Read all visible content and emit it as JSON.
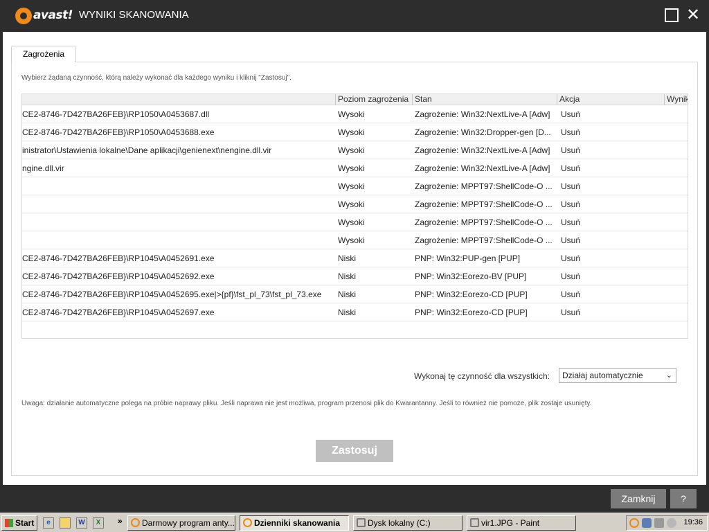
{
  "window": {
    "logo_text": "avast!",
    "title": "WYNIKI SKANOWANIA",
    "close_glyph": "✕"
  },
  "tab": {
    "label": "Zagrożenia"
  },
  "instructions": "Wybierz żądaną czynność, którą należy wykonać dla każdego wyniku i kliknij \"Zastosuj\".",
  "table": {
    "columns": [
      "Poziom zagrożenia",
      "Stan",
      "Akcja",
      "Wynik"
    ],
    "rows": [
      {
        "path": "CE2-8746-7D427BA26FEB}\\RP1050\\A0453687.dll",
        "level": "Wysoki",
        "state": "Zagrożenie: Win32:NextLive-A [Adw]",
        "action": "Usuń"
      },
      {
        "path": "CE2-8746-7D427BA26FEB}\\RP1050\\A0453688.exe",
        "level": "Wysoki",
        "state": "Zagrożenie: Win32:Dropper-gen [D...",
        "action": "Usuń"
      },
      {
        "path": "inistrator\\Ustawienia lokalne\\Dane aplikacji\\genienext\\nengine.dll.vir",
        "level": "Wysoki",
        "state": "Zagrożenie: Win32:NextLive-A [Adw]",
        "action": "Usuń"
      },
      {
        "path": "ngine.dll.vir",
        "level": "Wysoki",
        "state": "Zagrożenie: Win32:NextLive-A [Adw]",
        "action": "Usuń"
      },
      {
        "path": "",
        "level": "Wysoki",
        "state": "Zagrożenie: MPPT97:ShellCode-O ...",
        "action": "Usuń"
      },
      {
        "path": "",
        "level": "Wysoki",
        "state": "Zagrożenie: MPPT97:ShellCode-O ...",
        "action": "Usuń"
      },
      {
        "path": "",
        "level": "Wysoki",
        "state": "Zagrożenie: MPPT97:ShellCode-O ...",
        "action": "Usuń"
      },
      {
        "path": "",
        "level": "Wysoki",
        "state": "Zagrożenie: MPPT97:ShellCode-O ...",
        "action": "Usuń"
      },
      {
        "path": "CE2-8746-7D427BA26FEB}\\RP1045\\A0452691.exe",
        "level": "Niski",
        "state": "PNP: Win32:PUP-gen [PUP]",
        "action": "Usuń"
      },
      {
        "path": "CE2-8746-7D427BA26FEB}\\RP1045\\A0452692.exe",
        "level": "Niski",
        "state": "PNP: Win32:Eorezo-BV [PUP]",
        "action": "Usuń"
      },
      {
        "path": "CE2-8746-7D427BA26FEB}\\RP1045\\A0452695.exe|>{pf}\\fst_pl_73\\fst_pl_73.exe",
        "level": "Niski",
        "state": "PNP: Win32:Eorezo-CD [PUP]",
        "action": "Usuń"
      },
      {
        "path": "CE2-8746-7D427BA26FEB}\\RP1045\\A0452697.exe",
        "level": "Niski",
        "state": "PNP: Win32:Eorezo-CD [PUP]",
        "action": "Usuń"
      }
    ],
    "result_dots": "..."
  },
  "bulk": {
    "label": "Wykonaj tę czynność dla wszystkich:",
    "selected": "Działaj automatycznie"
  },
  "note": "Uwaga: działanie automatyczne polega na próbie naprawy pliku. Jeśli naprawa nie jest możliwa, program przenosi plik do Kwarantanny. Jeśli to również nie pomoże, plik zostaje usunięty.",
  "apply_label": "Zastosuj",
  "footer": {
    "close_label": "Zamknij",
    "help_label": "?"
  },
  "taskbar": {
    "start_label": "Start",
    "more_glyph": "»",
    "tasks": [
      {
        "label": "Darmowy program anty..."
      },
      {
        "label": "Dzienniki skanowania"
      },
      {
        "label": "Dysk lokalny (C:)"
      },
      {
        "label": "vir1.JPG - Paint"
      }
    ],
    "clock": "19:36"
  },
  "colors": {
    "accent": "#f08a1c",
    "ok_green": "#3fa535",
    "chrome": "#2d2d2d"
  }
}
